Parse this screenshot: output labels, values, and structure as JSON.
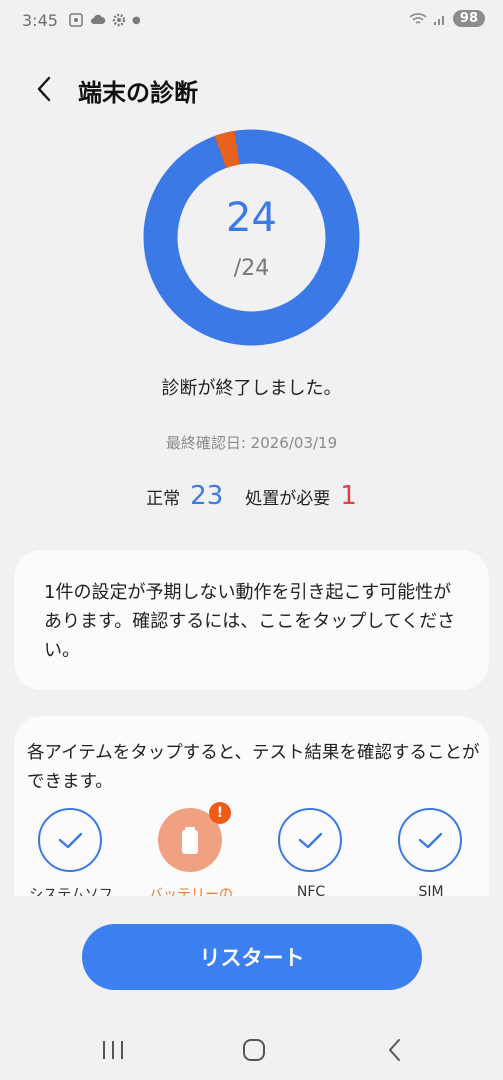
{
  "status_bar": {
    "time": "3:45",
    "battery": "98"
  },
  "header": {
    "title": "端末の診断"
  },
  "donut": {
    "completed": 24,
    "total": 24,
    "count_text": "24",
    "total_text": "/24",
    "normal_color": "#3a79e6",
    "warning_color": "#e8621f"
  },
  "result": {
    "message": "診断が終了しました。",
    "last_check": "最終確認日: 2026/03/19",
    "normal_label": "正常",
    "normal_count": "23",
    "action_label": "処置が必要",
    "action_count": "1"
  },
  "alert_card": {
    "text": "1件の設定が予期しない動作を引き起こす可能性があります。確認するには、ここをタップしてください。"
  },
  "items_card": {
    "text": "各アイテムをタップすると、テスト結果を確認することができます。",
    "items": [
      {
        "label": "システムソフ",
        "status": "ok"
      },
      {
        "label": "バッテリーの",
        "status": "warning"
      },
      {
        "label": "NFC",
        "status": "ok"
      },
      {
        "label": "SIM",
        "status": "ok"
      }
    ]
  },
  "restart_button": {
    "label": "リスタート"
  },
  "colors": {
    "accent": "#3b7ff0",
    "warning": "#f07a33",
    "error": "#e04040"
  }
}
